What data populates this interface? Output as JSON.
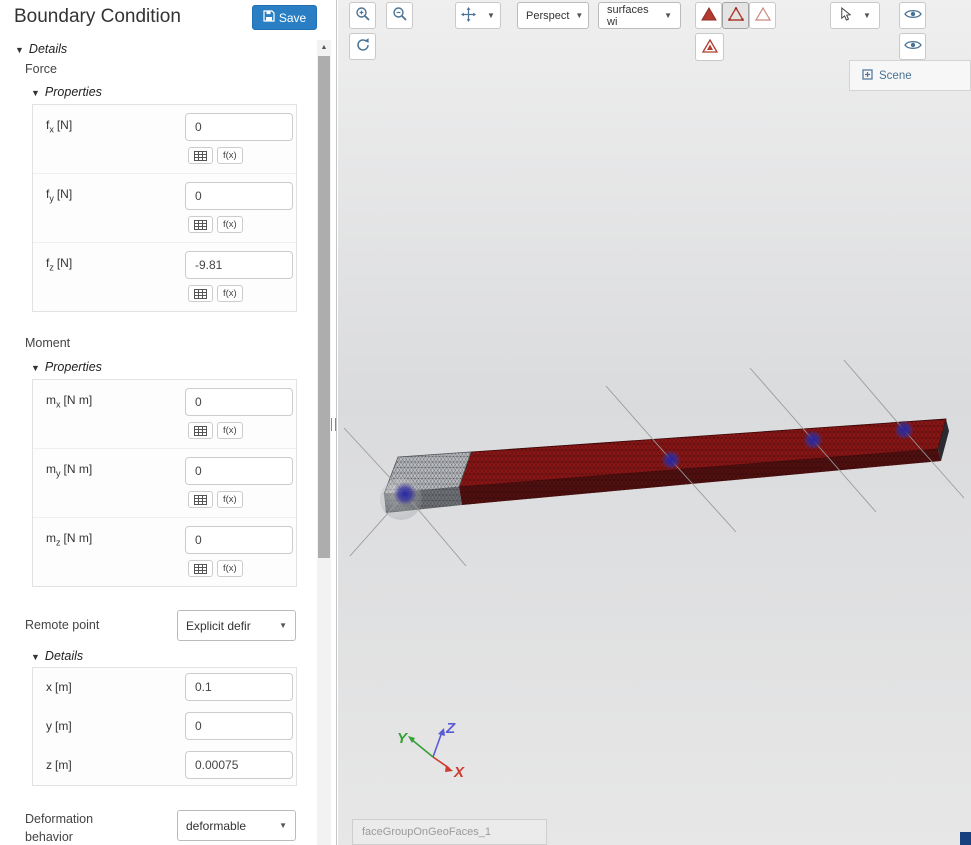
{
  "header": {
    "title": "Boundary Condition",
    "save": "Save"
  },
  "panel": {
    "details_label": "Details",
    "formula_label": "f(x)",
    "force": {
      "title": "Force",
      "properties_label": "Properties",
      "fields": [
        {
          "base": "f",
          "sub": "x",
          "unit": "[N]",
          "value": "0"
        },
        {
          "base": "f",
          "sub": "y",
          "unit": "[N]",
          "value": "0"
        },
        {
          "base": "f",
          "sub": "z",
          "unit": "[N]",
          "value": "-9.81"
        }
      ]
    },
    "moment": {
      "title": "Moment",
      "properties_label": "Properties",
      "fields": [
        {
          "base": "m",
          "sub": "x",
          "unit": "[N m]",
          "value": "0"
        },
        {
          "base": "m",
          "sub": "y",
          "unit": "[N m]",
          "value": "0"
        },
        {
          "base": "m",
          "sub": "z",
          "unit": "[N m]",
          "value": "0"
        }
      ]
    },
    "remote": {
      "label": "Remote point",
      "value": "Explicit defir",
      "details_label": "Details",
      "coords": [
        {
          "base": "x",
          "unit": "[m]",
          "value": "0.1"
        },
        {
          "base": "y",
          "unit": "[m]",
          "value": "0"
        },
        {
          "base": "z",
          "unit": "[m]",
          "value": "0.00075"
        }
      ]
    },
    "deformation": {
      "label": "Deformation behavior",
      "value": "deformable"
    }
  },
  "toolbar": {
    "perspective": "Perspect",
    "surfaces": "surfaces wi",
    "scene": "Scene"
  },
  "viewport": {
    "face_group": "faceGroupOnGeoFaces_1",
    "axes": {
      "x": "X",
      "y": "Y",
      "z": "Z"
    }
  },
  "colors": {
    "accent_blue": "#2a7fc4",
    "beam_red": "#8e1616",
    "mesh_gray": "#b9bcc0",
    "load_blue": "#2626a8",
    "axis_x": "#cc3b30",
    "axis_y": "#35a035",
    "axis_z": "#5b5bd6"
  },
  "icons": [
    "save-icon",
    "zoom-in-icon",
    "zoom-out-icon",
    "pan-icon",
    "refresh-icon",
    "mesh-red-filled-icon",
    "mesh-red-outline-icon",
    "mesh-outline-icon",
    "mesh-quality-icon",
    "cursor-icon",
    "eye-icon",
    "scene-add-icon",
    "table-icon",
    "caret-down-icon",
    "collapse-triangle-icon",
    "scroll-up-icon"
  ]
}
